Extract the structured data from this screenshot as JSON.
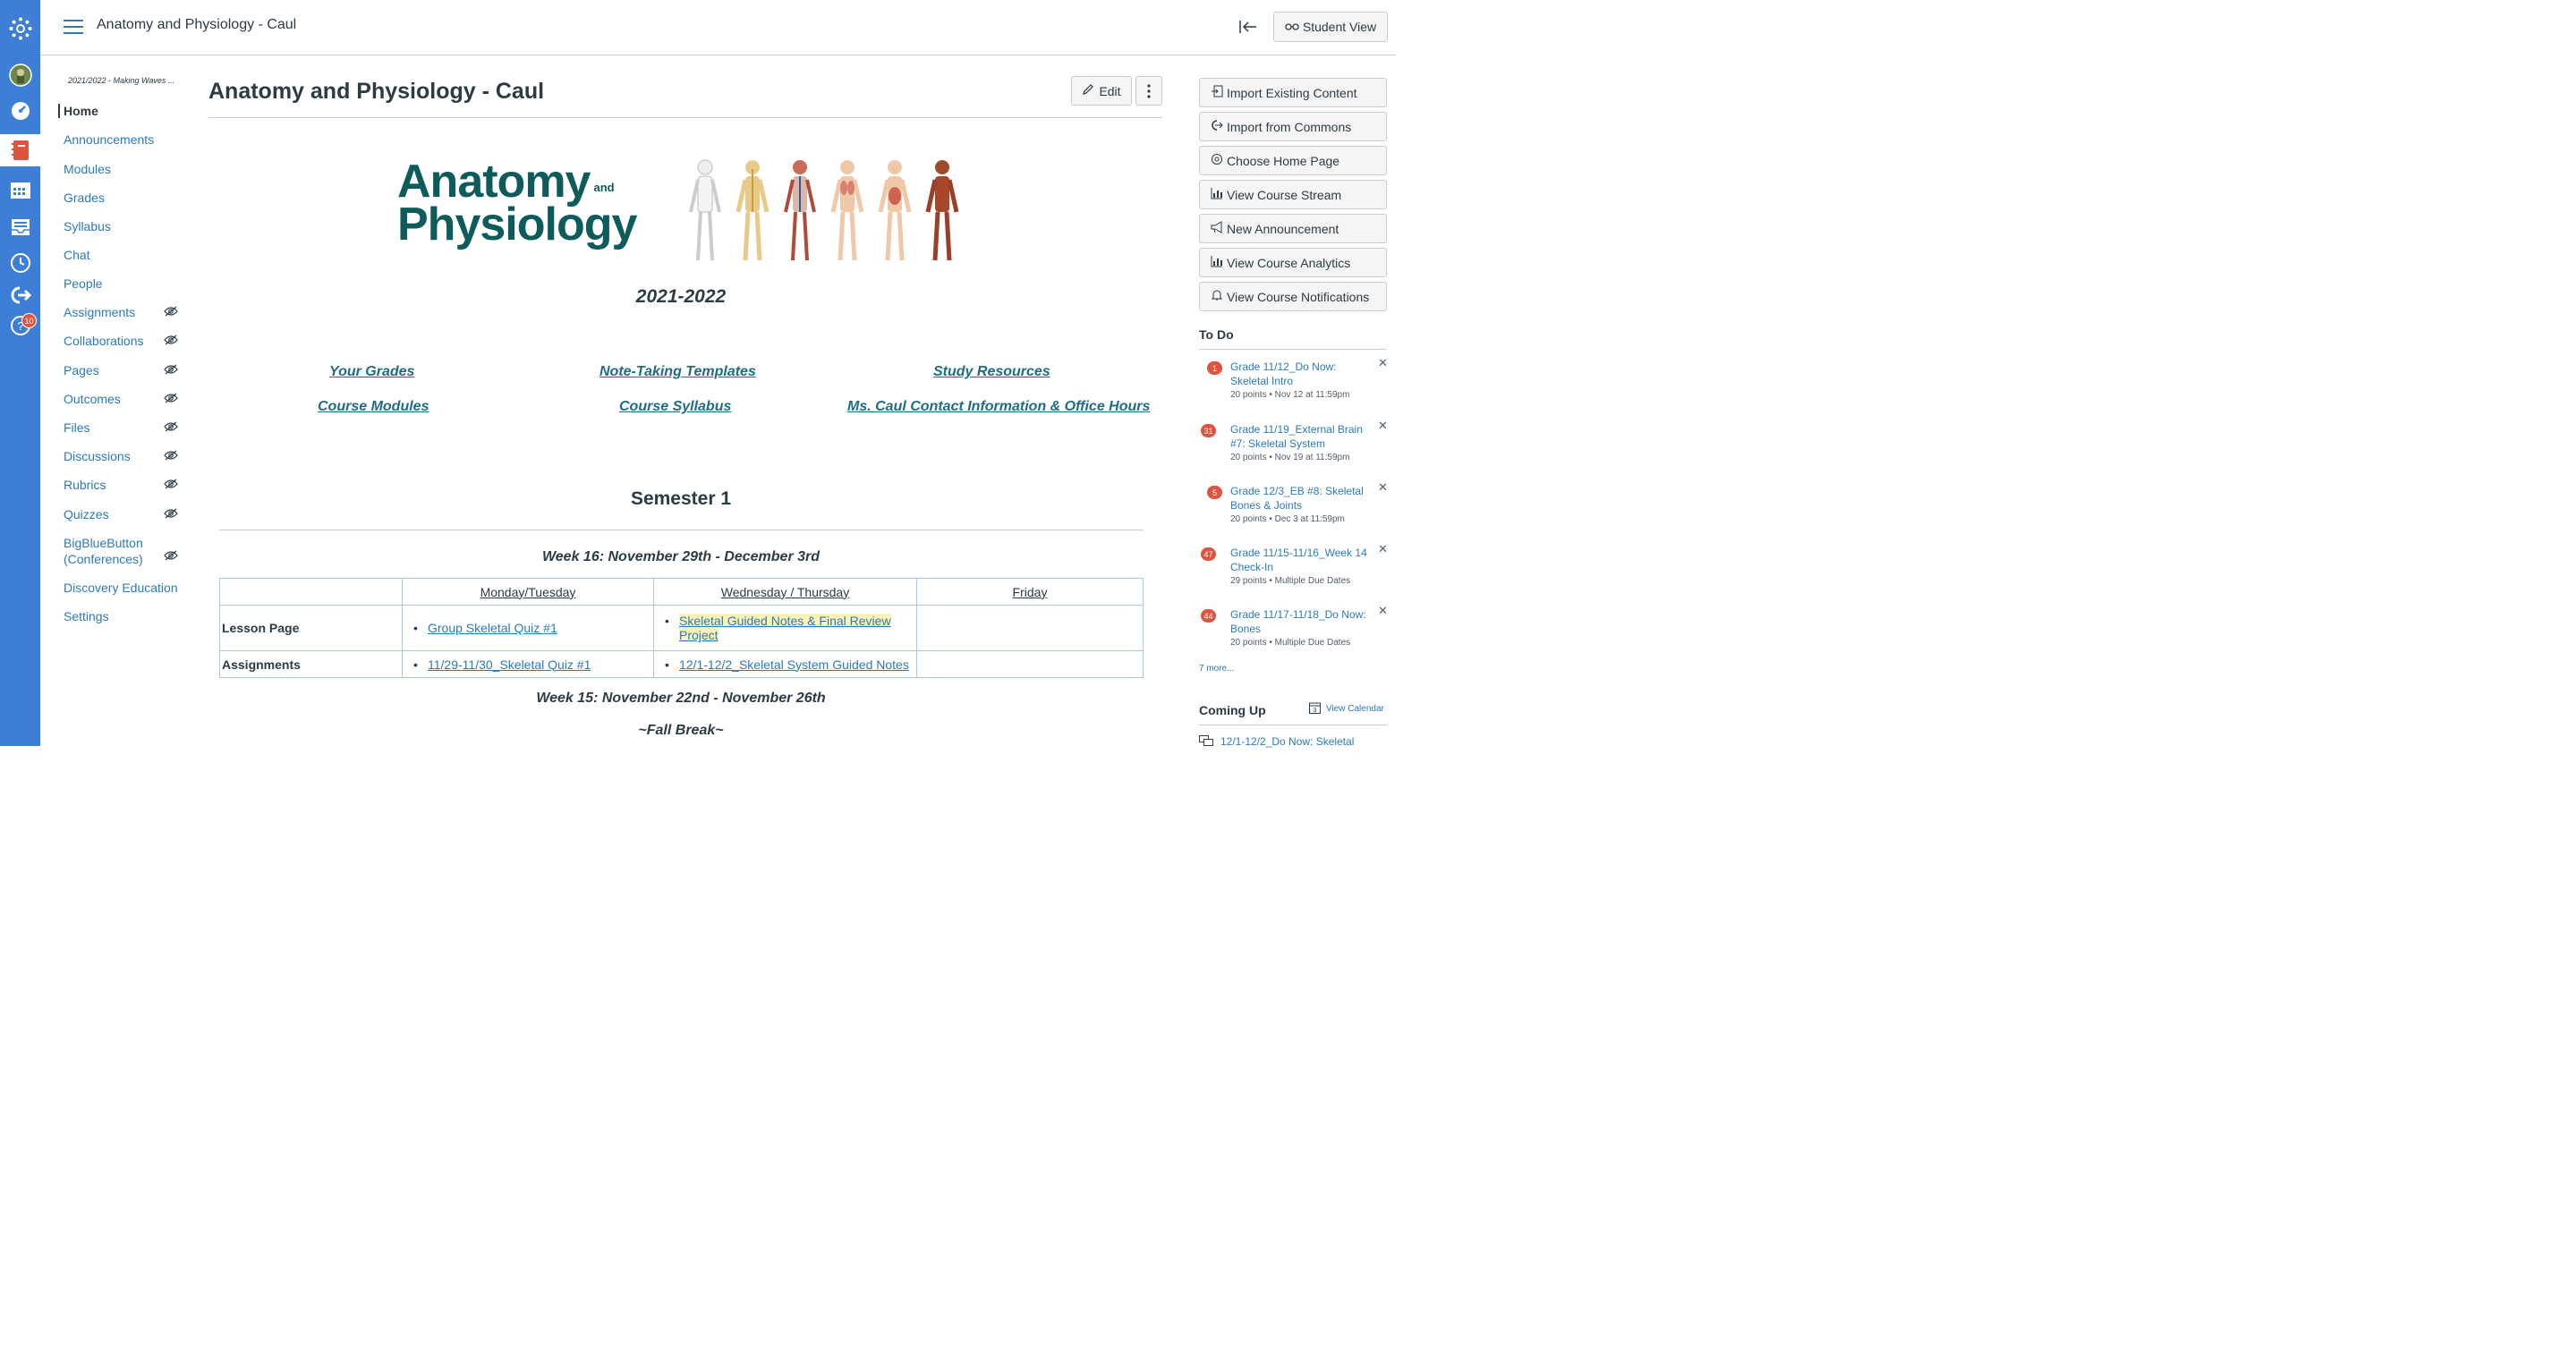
{
  "header": {
    "course_breadcrumb": "Anatomy and Physiology - Caul",
    "student_view_label": "Student View"
  },
  "global_nav": {
    "badge_count": "10"
  },
  "course_nav": {
    "term": "2021/2022 - Making Waves ...",
    "items": [
      {
        "label": "Home"
      },
      {
        "label": "Announcements"
      },
      {
        "label": "Modules"
      },
      {
        "label": "Grades"
      },
      {
        "label": "Syllabus"
      },
      {
        "label": "Chat"
      },
      {
        "label": "People"
      },
      {
        "label": "Assignments"
      },
      {
        "label": "Collaborations"
      },
      {
        "label": "Pages"
      },
      {
        "label": "Outcomes"
      },
      {
        "label": "Files"
      },
      {
        "label": "Discussions"
      },
      {
        "label": "Rubrics"
      },
      {
        "label": "Quizzes"
      },
      {
        "label": "BigBlueButton (Conferences)"
      },
      {
        "label": "Discovery Education"
      },
      {
        "label": "Settings"
      }
    ]
  },
  "main": {
    "page_title": "Anatomy and Physiology - Caul",
    "edit_label": "Edit",
    "banner": {
      "line1": "Anatomy",
      "and": "and",
      "line2": "Physiology"
    },
    "year": "2021-2022",
    "quick_links": [
      "Your Grades",
      "Note-Taking Templates",
      "Study Resources",
      "Course Modules",
      "Course Syllabus",
      "Ms. Caul Contact Information & Office Hours"
    ],
    "semester_heading": "Semester 1",
    "week16_heading": "Week 16: November 29th - December 3rd",
    "table": {
      "headers": [
        "",
        "Monday/Tuesday",
        "Wednesday / Thursday",
        "Friday"
      ],
      "rows": [
        {
          "label": "Lesson Page",
          "mon": "Group Skeletal Quiz #1",
          "wed": "Skeletal Guided Notes & Final Review Project",
          "fri": ""
        },
        {
          "label": "Assignments",
          "mon": "11/29-11/30_Skeletal Quiz #1",
          "wed": "12/1-12/2_Skeletal System Guided Notes",
          "fri": ""
        }
      ]
    },
    "week15_heading": "Week 15: November 22nd - November 26th",
    "fall_break": "~Fall Break~"
  },
  "sidebar": {
    "buttons": [
      "Import Existing Content",
      "Import from Commons",
      "Choose Home Page",
      "View Course Stream",
      "New Announcement",
      "View Course Analytics",
      "View Course Notifications"
    ],
    "todo_heading": "To Do",
    "todos": [
      {
        "count": "1",
        "title": "Grade 11/12_Do Now: Skeletal Intro",
        "meta": "20 points • Nov 12 at 11:59pm"
      },
      {
        "count": "31",
        "title": "Grade 11/19_External Brain #7: Skeletal System",
        "meta": "20 points • Nov 19 at 11:59pm"
      },
      {
        "count": "5",
        "title": "Grade 12/3_EB #8: Skeletal Bones & Joints",
        "meta": "20 points • Dec 3 at 11:59pm"
      },
      {
        "count": "47",
        "title": "Grade 11/15-11/16_Week 14 Check-In",
        "meta": "29 points • Multiple Due Dates"
      },
      {
        "count": "44",
        "title": "Grade 11/17-11/18_Do Now: Bones",
        "meta": "20 points • Multiple Due Dates"
      }
    ],
    "more_label": "7 more...",
    "coming_up_heading": "Coming Up",
    "view_calendar_label": "View Calendar",
    "calendar_day": "3",
    "coming_up_first": "12/1-12/2_Do Now: Skeletal"
  },
  "colors": {
    "global_nav": "#3d7fd6",
    "link": "#2b7abc",
    "banner_teal": "#0d5b5b",
    "badge": "#e0533d"
  }
}
